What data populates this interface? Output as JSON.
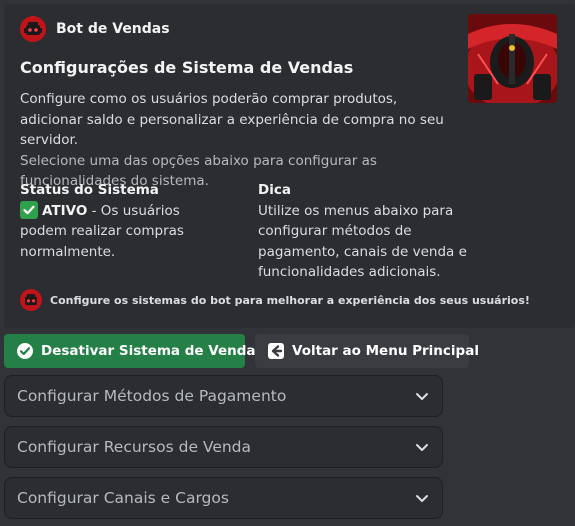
{
  "embed": {
    "author": "Bot de Vendas",
    "title": "Configurações de Sistema de Vendas",
    "description_line1": "Configure como os usuários poderão comprar produtos, adicionar saldo e personalizar a experiência de compra no seu servidor.",
    "description_line2": "Selecione uma das opções abaixo para configurar as funcionalidades do sistema.",
    "fields": {
      "status_name": "Status do Sistema",
      "status_badge": "ATIVO",
      "status_value": " - Os usuários podem realizar compras normalmente.",
      "tip_name": "Dica",
      "tip_value": "Utilize os menus abaixo para configurar métodos de pagamento, canais de venda e funcionalidades adicionais."
    },
    "footer": "Configure os sistemas do bot para melhorar a experiência dos seus usuários!"
  },
  "buttons": {
    "disable": "Desativar Sistema de Vendas",
    "back": "Voltar ao Menu Principal"
  },
  "selects": [
    {
      "label": "Configurar Métodos de Pagamento"
    },
    {
      "label": "Configurar Recursos de Venda"
    },
    {
      "label": "Configurar Canais e Cargos"
    }
  ],
  "colors": {
    "background": "#313338",
    "embed": "#2b2d31",
    "success": "#248046",
    "secondary": "#3a3c42"
  },
  "icons": [
    "bot-avatar-icon",
    "car-thumbnail",
    "check-circle-icon",
    "back-arrow-icon",
    "chevron-down-icon"
  ]
}
